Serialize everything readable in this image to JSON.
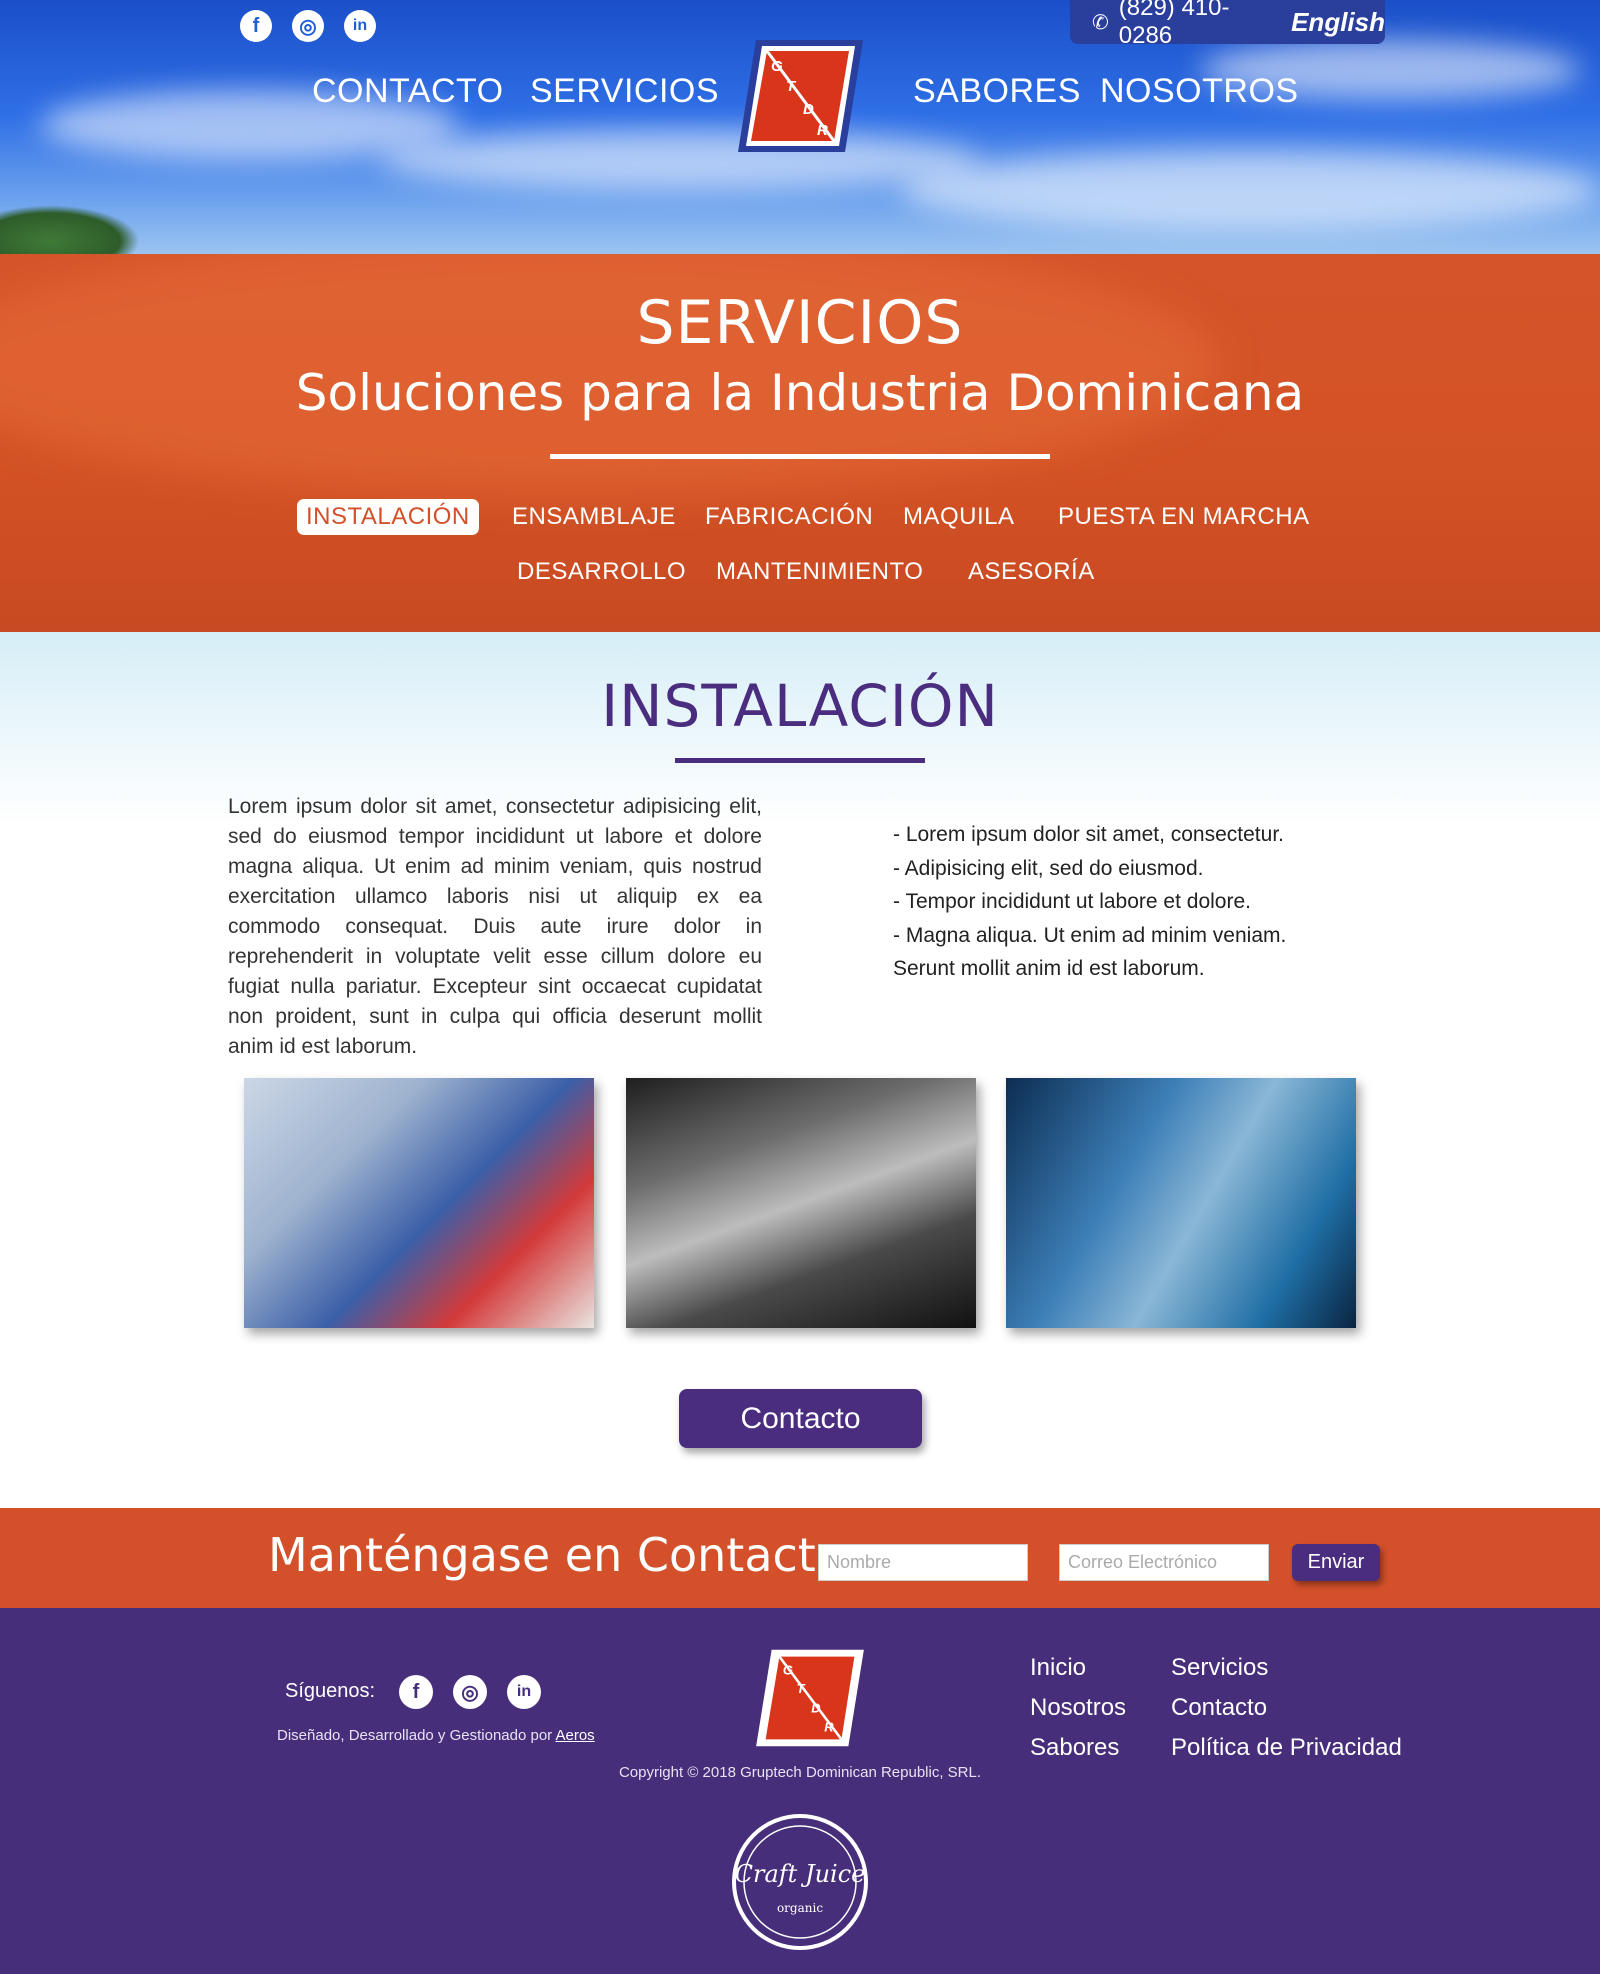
{
  "colors": {
    "orange": "#d3502a",
    "purple": "#4b2d80",
    "footer_purple": "#472e7a",
    "phone_bar": "#2a3e9c",
    "logo_red": "#d9351a"
  },
  "header": {
    "social_icons": [
      "facebook-icon",
      "instagram-icon",
      "linkedin-icon"
    ],
    "social_glyphs": {
      "facebook": "f",
      "instagram": "◎",
      "linkedin": "in"
    },
    "phone_glyph": "✆",
    "phone": "(829) 410-0286",
    "language": "English",
    "nav_left": [
      "CONTACTO",
      "SERVICIOS"
    ],
    "nav_right": [
      "SABORES",
      "NOSOTROS"
    ],
    "logo_letters": [
      "G",
      "T",
      "D",
      "R"
    ]
  },
  "banner": {
    "title": "SERVICIOS",
    "subtitle": "Soluciones para la Industria Dominicana",
    "tabs_row1": [
      "INSTALACIÓN",
      "ENSAMBLAJE",
      "FABRICACIÓN",
      "MAQUILA",
      "PUESTA EN MARCHA"
    ],
    "tabs_row2": [
      "DESARROLLO",
      "MANTENIMIENTO",
      "ASESORÍA"
    ],
    "active_tab": "INSTALACIÓN"
  },
  "content": {
    "title": "INSTALACIÓN",
    "paragraph": "Lorem ipsum dolor sit amet, consectetur adipisicing elit, sed do eiusmod tempor incididunt ut labore et dolore magna aliqua. Ut enim ad minim veniam, quis nostrud exercitation ullamco laboris nisi ut aliquip ex ea commodo consequat. Duis aute irure dolor in reprehenderit in voluptate velit esse cillum dolore eu fugiat nulla pariatur. Excepteur sint occaecat cupidatat non proident, sunt in culpa qui officia deserunt mollit anim id est laborum.",
    "bullets": [
      "- Lorem ipsum dolor sit amet, consectetur.",
      "- Adipisicing elit, sed do eiusmod.",
      "- Tempor incididunt ut labore et dolore.",
      "- Magna aliqua. Ut enim ad minim veniam.",
      "Serunt mollit anim id est laborum."
    ],
    "contact_button": "Contacto"
  },
  "newsletter": {
    "title": "Manténgase en Contacto",
    "name_placeholder": "Nombre",
    "email_placeholder": "Correo Electrónico",
    "send_button": "Enviar"
  },
  "footer": {
    "follow_label": "Síguenos:",
    "credits_prefix": "Diseñado, Desarrollado y Gestionado por",
    "credits_link": "Aeros",
    "copyright": "Copyright © 2018 Gruptech Dominican Republic, SRL.",
    "links_col1": [
      "Inicio",
      "Nosotros",
      "Sabores"
    ],
    "links_col2": [
      "Servicios",
      "Contacto",
      "Política de Privacidad"
    ],
    "badge_text": "Craft Juice",
    "badge_sub": "organic"
  }
}
